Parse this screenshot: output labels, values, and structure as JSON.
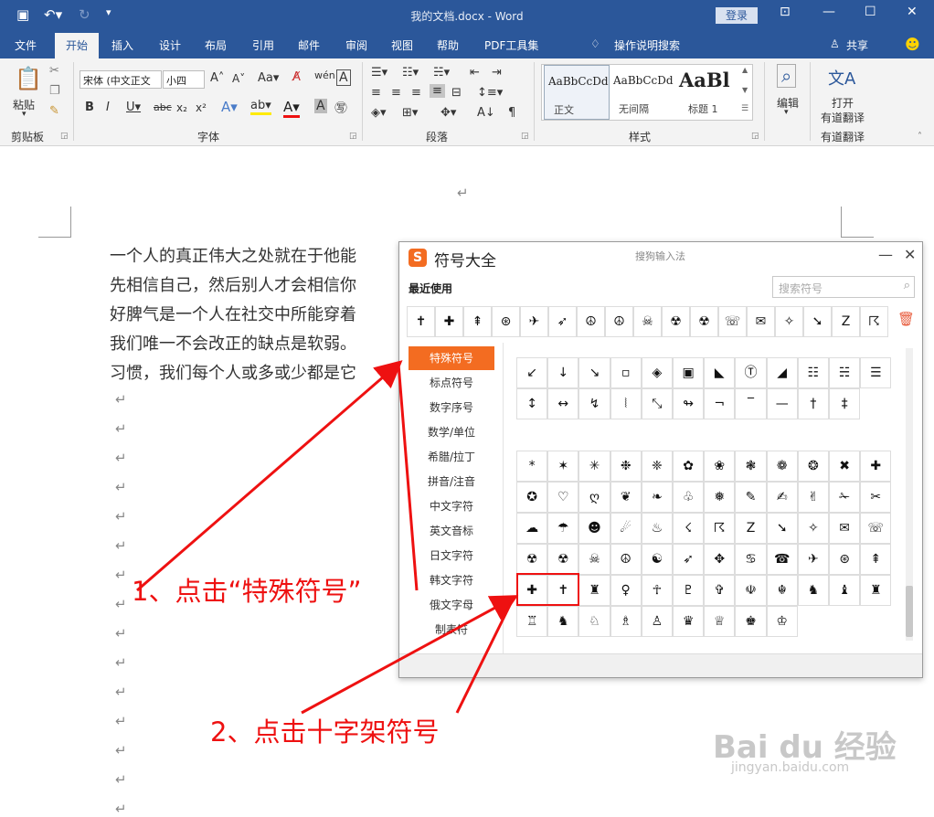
{
  "window": {
    "title": "我的文档.docx - Word",
    "login": "登录",
    "share": "共享"
  },
  "tabs": [
    "文件",
    "开始",
    "插入",
    "设计",
    "布局",
    "引用",
    "邮件",
    "审阅",
    "视图",
    "帮助",
    "PDF工具集"
  ],
  "tell_me": "操作说明搜索",
  "ribbon": {
    "paste": "粘贴",
    "font_name": "宋体 (中文正文",
    "font_size": "小四",
    "groups": [
      "剪贴板",
      "字体",
      "段落",
      "样式",
      "有道翻译"
    ],
    "styles": [
      {
        "sample": "AaBbCcDd",
        "name": "正文"
      },
      {
        "sample": "AaBbCcDd",
        "name": "无间隔"
      },
      {
        "sample": "AaBl",
        "name": "标题 1"
      }
    ],
    "edit": "编辑",
    "translate_open": "打开",
    "translate_name": "有道翻译"
  },
  "document": {
    "lines": [
      "一个人的真正伟大之处就在于他能",
      "先相信自己，然后别人才会相信你",
      "好脾气是一个人在社交中所能穿着",
      "我们唯一不会改正的缺点是软弱。",
      "习惯，我们每个人或多或少都是它"
    ],
    "para_mark": "↵"
  },
  "dialog": {
    "title": "符号大全",
    "subtitle": "搜狗输入法",
    "recent_title": "最近使用",
    "search_placeholder": "搜索符号",
    "recent": [
      "✝",
      "✚",
      "⇞",
      "⊛",
      "✈",
      "➶",
      "☮",
      "☮",
      "☠",
      "☢",
      "☢",
      "☏",
      "✉",
      "✧",
      "➘",
      "Z",
      "☈"
    ],
    "nav": [
      "特殊符号",
      "标点符号",
      "数字序号",
      "数学/单位",
      "希腊/拉丁",
      "拼音/注音",
      "中文字符",
      "英文音标",
      "日文字符",
      "韩文字符",
      "俄文字母",
      "制表符"
    ],
    "grid_rows_top": [
      [
        "↙",
        "↓",
        "↘",
        "▫",
        "◈",
        "▣",
        "◣",
        "Ⓣ",
        "◢",
        "☷",
        "☵",
        "☰"
      ],
      [
        "↕",
        "↔",
        "↯",
        "⦚",
        "⤡",
        "↬",
        "¬",
        "‾",
        "—",
        "†",
        "‡",
        ""
      ]
    ],
    "grid_rows_bottom": [
      [
        "*",
        "✶",
        "✳",
        "❉",
        "❈",
        "✿",
        "❀",
        "❃",
        "❁",
        "❂",
        "✖",
        "✚"
      ],
      [
        "✪",
        "♡",
        "ღ",
        "❦",
        "❧",
        "♧",
        "❅",
        "✎",
        "✍",
        "✌",
        "✁",
        "✂"
      ],
      [
        "☁",
        "☂",
        "☻",
        "☄",
        "♨",
        "☇",
        "☈",
        "Z",
        "➘",
        "✧",
        "✉",
        "☏"
      ],
      [
        "☢",
        "☢",
        "☠",
        "☮",
        "☯",
        "➶",
        "✥",
        "♋",
        "☎",
        "✈",
        "⊛",
        "⇞"
      ],
      [
        "✚",
        "✝",
        "♜",
        "♀",
        "☥",
        "♇",
        "✞",
        "☫",
        "☬",
        "♞",
        "♝",
        "♜"
      ],
      [
        "♖",
        "♞",
        "♘",
        "♗",
        "♙",
        "♛",
        "♕",
        "♚",
        "♔"
      ]
    ]
  },
  "annotations": {
    "step1": "1、点击“特殊符号”",
    "step2": "2、点击十字架符号"
  },
  "watermark": {
    "text": "Bai du 经验",
    "url": "jingyan.baidu.com"
  },
  "colors": {
    "word_blue": "#2b579a",
    "sogou_orange": "#f36c21",
    "annotation_red": "#e11111"
  }
}
